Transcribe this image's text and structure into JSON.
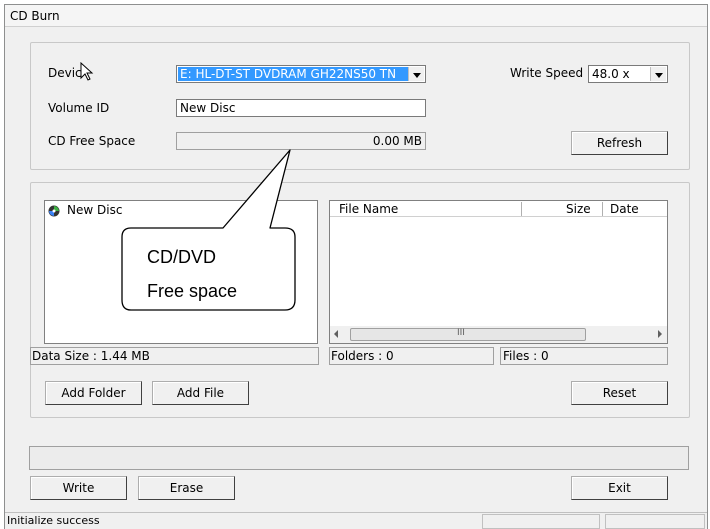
{
  "window": {
    "title": "CD Burn"
  },
  "device_section": {
    "device_label": "Devic",
    "device_value": "E: HL-DT-ST DVDRAM GH22NS50 TN",
    "write_speed_label": "Write Speed",
    "write_speed_value": "48.0 x",
    "volume_id_label": "Volume ID",
    "volume_id_value": "New Disc",
    "free_space_label": "CD Free Space",
    "free_space_value": "0.00 MB",
    "refresh_label": "Refresh"
  },
  "tree": {
    "root_label": "New Disc"
  },
  "file_list": {
    "columns": [
      "File Name",
      "Size",
      "Date"
    ],
    "scroll_thumb": "III"
  },
  "info": {
    "data_size": "Data Size : 1.44 MB",
    "folders": "Folders : 0",
    "files": "Files : 0"
  },
  "actions": {
    "add_folder": "Add Folder",
    "add_file": "Add File",
    "reset": "Reset",
    "write": "Write",
    "erase": "Erase",
    "exit": "Exit"
  },
  "status": {
    "message": "Initialize success"
  },
  "callout": {
    "line1": "CD/DVD",
    "line2": "Free space"
  }
}
